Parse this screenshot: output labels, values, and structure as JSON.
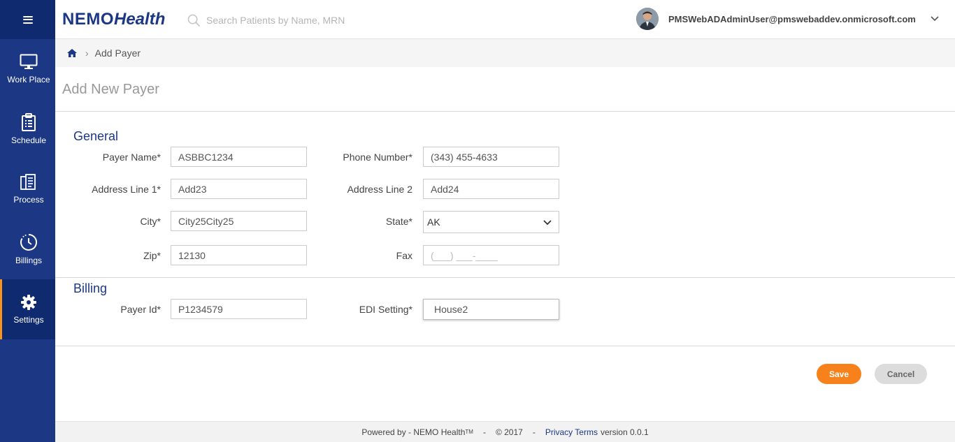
{
  "app": {
    "logo_main": "NEMO",
    "logo_sub": "Health"
  },
  "search": {
    "placeholder": "Search Patients by Name, MRN",
    "icon": "search-icon"
  },
  "user": {
    "email": "PMSWebADAdminUser@pmswebaddev.onmicrosoft.com"
  },
  "sidebar": {
    "items": [
      {
        "label": "Work Place",
        "icon": "monitor-icon"
      },
      {
        "label": "Schedule",
        "icon": "clipboard-icon"
      },
      {
        "label": "Process",
        "icon": "documents-icon"
      },
      {
        "label": "Billings",
        "icon": "clock-icon"
      },
      {
        "label": "Settings",
        "icon": "gear-icon",
        "active": true
      }
    ]
  },
  "breadcrumb": {
    "current": "Add Payer"
  },
  "page": {
    "title": "Add New Payer"
  },
  "form": {
    "general_title": "General",
    "billing_title": "Billing",
    "payer_name": {
      "label": "Payer Name*",
      "value": "ASBBC1234"
    },
    "phone_number": {
      "label": "Phone Number*",
      "value": "(343) 455-4633"
    },
    "address_line1": {
      "label": "Address Line 1*",
      "value": "Add23"
    },
    "address_line2": {
      "label": "Address Line 2",
      "value": "Add24"
    },
    "city": {
      "label": "City*",
      "value": "City25City25"
    },
    "state": {
      "label": "State*",
      "value": "AK"
    },
    "zip": {
      "label": "Zip*",
      "value": "12130"
    },
    "fax": {
      "label": "Fax",
      "placeholder": "(___) ___-____"
    },
    "payer_id": {
      "label": "Payer Id*",
      "value": "P1234579"
    },
    "edi_setting": {
      "label": "EDI Setting*",
      "value": "House2"
    }
  },
  "actions": {
    "save": "Save",
    "cancel": "Cancel"
  },
  "footer": {
    "powered_by": "Powered by - NEMO Health",
    "tm": "TM",
    "dash1": "-",
    "copyright": "© 2017",
    "dash2": "-",
    "privacy": "Privacy Terms",
    "version": "version 0.0.1"
  },
  "colors": {
    "brand_navy": "#1c3784",
    "dark_navy": "#0f2a6e",
    "accent_orange": "#f7821b"
  }
}
